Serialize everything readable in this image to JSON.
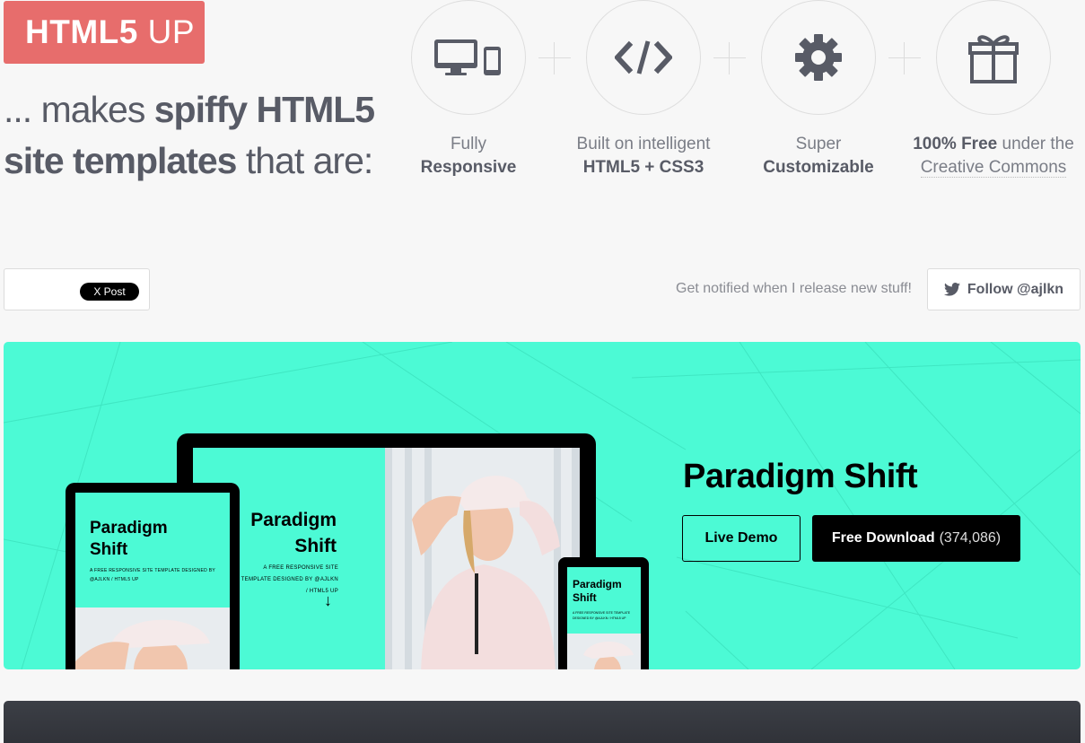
{
  "logo": {
    "bold": "HTML5",
    "light": " UP"
  },
  "tagline": {
    "part1": "... makes ",
    "bold1": "spiffy HTML5",
    "bold2": "site templates",
    "part2": " that are:"
  },
  "features": [
    {
      "icon": "devices-icon",
      "line1": "Fully",
      "line2": "Responsive"
    },
    {
      "icon": "code-icon",
      "line1": "Built on intelligent",
      "line2": "HTML5 + CSS3"
    },
    {
      "icon": "gear-icon",
      "line1": "Super",
      "line2": "Customizable"
    },
    {
      "icon": "gift-icon",
      "bold": "100% Free",
      "rest": " under the",
      "line2": "Creative Commons"
    }
  ],
  "social": {
    "post_label": "X Post",
    "notify_text": "Get notified when I release new stuff!",
    "follow_label": "Follow @ajlkn"
  },
  "featured": {
    "title": "Paradigm Shift",
    "live_demo": "Live Demo",
    "download_label": "Free Download",
    "download_count": "(374,086)",
    "accent": "#4cfad5",
    "mockup": {
      "title_line1": "Paradigm",
      "title_line2": "Shift",
      "subtitle": "A FREE RESPONSIVE SITE TEMPLATE DESIGNED BY @AJLKN / HTML5 UP",
      "arrow": "↓"
    }
  },
  "colors": {
    "logo_bg": "#e76d6c",
    "text": "#585b66",
    "background": "#f7f7f7"
  }
}
